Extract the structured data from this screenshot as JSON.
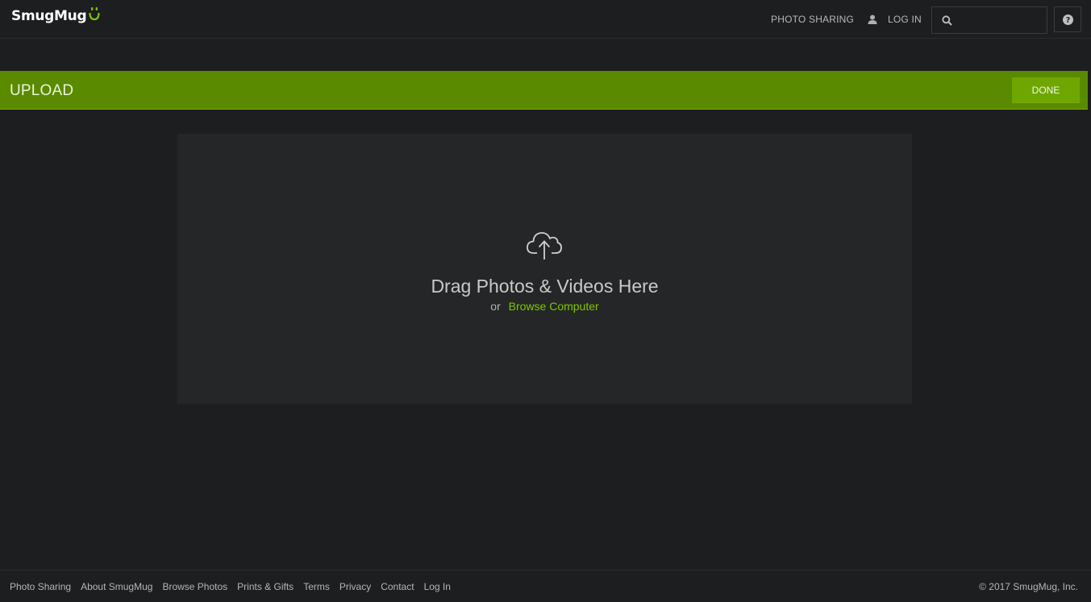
{
  "header": {
    "logo_text": "SmugMug",
    "nav_photo_sharing": "PHOTO SHARING",
    "nav_login": "LOG IN",
    "search_placeholder": "",
    "help_glyph": "?"
  },
  "upload": {
    "title": "UPLOAD",
    "done_label": "DONE",
    "drag_text": "Drag Photos & Videos Here",
    "or_text": "or",
    "browse_text": "Browse Computer"
  },
  "footer": {
    "links": [
      "Photo Sharing",
      "About SmugMug",
      "Browse Photos",
      "Prints & Gifts",
      "Terms",
      "Privacy",
      "Contact",
      "Log In"
    ],
    "copyright": "© 2017 SmugMug, Inc."
  },
  "colors": {
    "background": "#1d1e20",
    "accent_green": "#5a8a00",
    "done_button": "#6fa700",
    "link_green": "#7cc800",
    "dropzone": "#252628"
  },
  "icons": [
    "smugmug-logo-mark-icon",
    "user-icon",
    "search-icon",
    "help-icon",
    "cloud-upload-icon"
  ]
}
